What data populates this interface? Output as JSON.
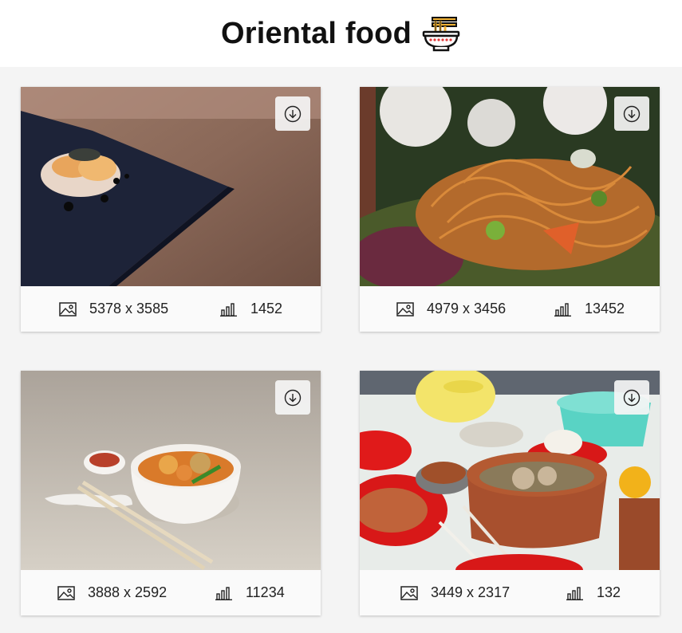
{
  "header": {
    "title": "Oriental food",
    "title_icon": "noodle-bowl-icon"
  },
  "cards": [
    {
      "name": "sushi",
      "dimensions": "5378 x 3585",
      "downloads": "1452"
    },
    {
      "name": "noodle-salad",
      "dimensions": "4979 x 3456",
      "downloads": "13452"
    },
    {
      "name": "curry-noodle-bowl",
      "dimensions": "3888 x 2592",
      "downloads": "11234"
    },
    {
      "name": "dim-sum",
      "dimensions": "3449 x 2317",
      "downloads": "132"
    }
  ],
  "icons": {
    "download": "download-circle-icon",
    "resolution": "image-icon",
    "downloads": "bar-chart-icon"
  }
}
